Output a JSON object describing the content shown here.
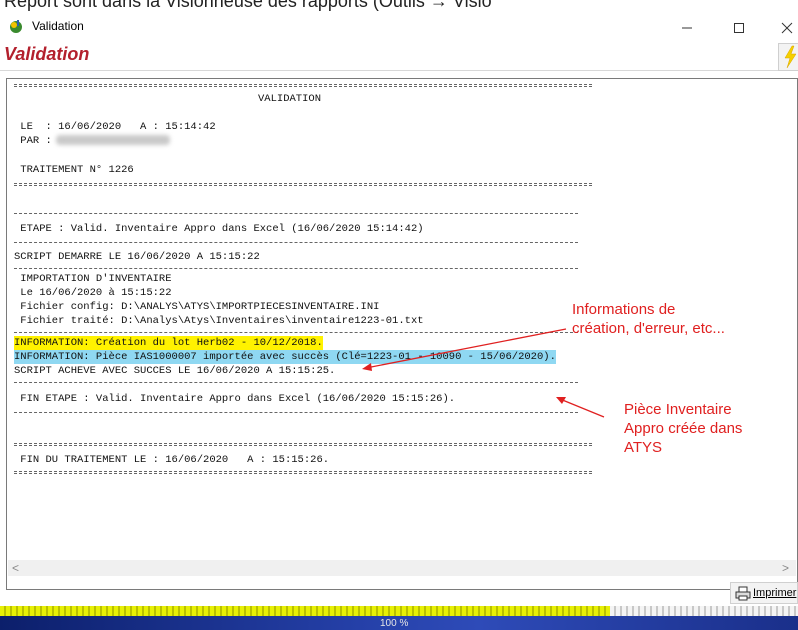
{
  "page_top_snippet": "Report sont dans la Visionneuse des rapports (Outils → Visio",
  "window": {
    "title": "Validation"
  },
  "header": {
    "title": "Validation"
  },
  "report": {
    "lines": [
      "VALIDATION",
      " LE  : 16/06/2020   A : 15:14:42",
      " PAR :",
      " TRAITEMENT N° 1226",
      " ETAPE : Valid. Inventaire Appro dans Excel (16/06/2020 15:14:42)",
      "SCRIPT DEMARRE LE 16/06/2020 A 15:15:22",
      " IMPORTATION D'INVENTAIRE",
      " Le 16/06/2020 à 15:15:22",
      " Fichier config: D:\\ANALYS\\ATYS\\IMPORTPIECESINVENTAIRE.INI",
      " Fichier traité: D:\\Analys\\Atys\\Inventaires\\inventaire1223-01.txt",
      "INFORMATION: Création du lot Herb02 - 10/12/2018.",
      "INFORMATION: Pièce IAS1000007 importée avec succès (Clé=1223-01 - 10090 - 15/06/2020).",
      "SCRIPT ACHEVE AVEC SUCCES LE 16/06/2020 A 15:15:25.",
      " FIN ETAPE : Valid. Inventaire Appro dans Excel (16/06/2020 15:15:26).",
      " FIN DU TRAITEMENT LE : 16/06/2020   A : 15:15:26."
    ]
  },
  "annotations": {
    "info_note": "Informations de\ncréation, d'erreur, etc...",
    "piece_note": "Pièce Inventaire\nAppro créée dans\nATYS"
  },
  "toolbar": {
    "print_label": "Imprimer"
  },
  "status": {
    "progress_text": "100 %"
  },
  "colors": {
    "header_title": "#b3202d",
    "annotation": "#e02020",
    "highlight_info": "#fff200",
    "highlight_piece": "#8fd8f2"
  }
}
